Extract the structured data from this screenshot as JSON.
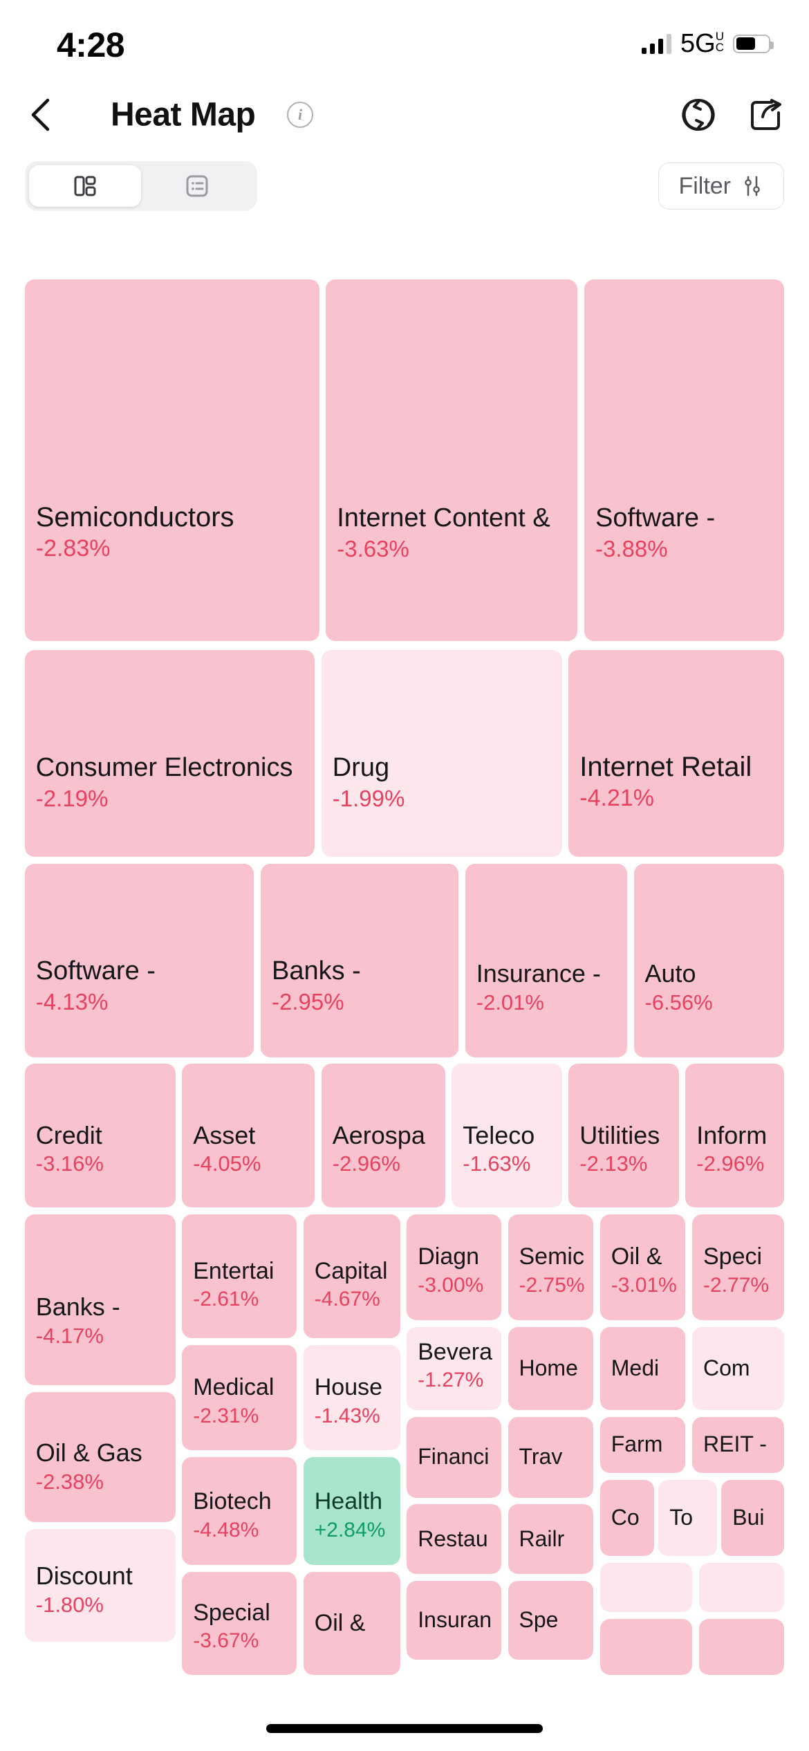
{
  "status_bar": {
    "time": "4:28",
    "network_label": "5G",
    "network_sup_top": "U",
    "network_sup_bottom": "C",
    "signal_icon": "cellular-bars-icon",
    "battery_icon": "battery-icon",
    "battery_level_pct": 62
  },
  "header": {
    "back_icon": "chevron-left-icon",
    "title": "Heat Map",
    "info_icon": "info-circle-icon",
    "info_glyph": "i",
    "refresh_icon": "refresh-icon",
    "share_icon": "share-export-icon"
  },
  "toolbar": {
    "view_toggle": {
      "options": [
        {
          "id": "grid",
          "icon": "grid-view-icon",
          "active": true
        },
        {
          "id": "list",
          "icon": "list-view-icon",
          "active": false
        }
      ]
    },
    "filter_label": "Filter",
    "filter_icon": "sliders-icon"
  },
  "colors": {
    "down_strong": "#f8c3ce",
    "down_mid": "#fac8d1",
    "down_light": "#fbdbe2",
    "down_lightest": "#fde7ec",
    "up_green_bg": "#a9e5cd",
    "pct_red": "#e8415f",
    "pct_green": "#0f9d67",
    "label_dark": "#15151a"
  },
  "chart_data": {
    "type": "treemap",
    "title": "Heat Map",
    "value_unit": "percent_change",
    "legend": "red = decline, green = gain; lighter shade = smaller move",
    "tiles": [
      {
        "label": "Semiconductors",
        "value": -2.83,
        "display": "-2.83%",
        "shade": "down_strong"
      },
      {
        "label": "Internet Content &",
        "value": -3.63,
        "display": "-3.63%",
        "shade": "down_strong"
      },
      {
        "label": "Software -",
        "value": -3.88,
        "display": "-3.88%",
        "shade": "down_strong"
      },
      {
        "label": "Consumer Electronics",
        "value": -2.19,
        "display": "-2.19%",
        "shade": "down_strong"
      },
      {
        "label": "Drug",
        "value": -1.99,
        "display": "-1.99%",
        "shade": "down_lightest"
      },
      {
        "label": "Internet Retail",
        "value": -4.21,
        "display": "-4.21%",
        "shade": "down_strong"
      },
      {
        "label": "Software -",
        "value": -4.13,
        "display": "-4.13%",
        "shade": "down_strong"
      },
      {
        "label": "Banks -",
        "value": -2.95,
        "display": "-2.95%",
        "shade": "down_strong"
      },
      {
        "label": "Insurance -",
        "value": -2.01,
        "display": "-2.01%",
        "shade": "down_strong"
      },
      {
        "label": "Auto",
        "value": -6.56,
        "display": "-6.56%",
        "shade": "down_strong"
      },
      {
        "label": "Credit",
        "value": -3.16,
        "display": "-3.16%",
        "shade": "down_strong"
      },
      {
        "label": "Asset",
        "value": -4.05,
        "display": "-4.05%",
        "shade": "down_strong"
      },
      {
        "label": "Aerospa",
        "value": -2.96,
        "display": "-2.96%",
        "shade": "down_strong"
      },
      {
        "label": "Teleco",
        "value": -1.63,
        "display": "-1.63%",
        "shade": "down_lightest"
      },
      {
        "label": "Utilities",
        "value": -2.13,
        "display": "-2.13%",
        "shade": "down_strong"
      },
      {
        "label": "Inform",
        "value": -2.96,
        "display": "-2.96%",
        "shade": "down_strong"
      },
      {
        "label": "Banks -",
        "value": -4.17,
        "display": "-4.17%",
        "shade": "down_strong"
      },
      {
        "label": "Entertai",
        "value": -2.61,
        "display": "-2.61%",
        "shade": "down_strong"
      },
      {
        "label": "Capital",
        "value": -4.67,
        "display": "-4.67%",
        "shade": "down_strong"
      },
      {
        "label": "Diagn",
        "value": -3.0,
        "display": "-3.00%",
        "shade": "down_strong"
      },
      {
        "label": "Semic",
        "value": -2.75,
        "display": "-2.75%",
        "shade": "down_strong"
      },
      {
        "label": "Oil &",
        "value": -3.01,
        "display": "-3.01%",
        "shade": "down_strong"
      },
      {
        "label": "Speci",
        "value": -2.77,
        "display": "-2.77%",
        "shade": "down_strong"
      },
      {
        "label": "Medical",
        "value": -2.31,
        "display": "-2.31%",
        "shade": "down_strong"
      },
      {
        "label": "House",
        "value": -1.43,
        "display": "-1.43%",
        "shade": "down_lightest"
      },
      {
        "label": "Bevera",
        "value": -1.27,
        "display": "-1.27%",
        "shade": "down_lightest"
      },
      {
        "label": "Home",
        "value": null,
        "display": "",
        "shade": "down_strong"
      },
      {
        "label": "Medi",
        "value": null,
        "display": "",
        "shade": "down_strong"
      },
      {
        "label": "Com",
        "value": null,
        "display": "",
        "shade": "down_lightest"
      },
      {
        "label": "Oil & Gas",
        "value": -2.38,
        "display": "-2.38%",
        "shade": "down_strong"
      },
      {
        "label": "Biotech",
        "value": -4.48,
        "display": "-4.48%",
        "shade": "down_strong"
      },
      {
        "label": "Health",
        "value": 2.84,
        "display": "+2.84%",
        "shade": "up_green_bg"
      },
      {
        "label": "Financi",
        "value": null,
        "display": "",
        "shade": "down_strong"
      },
      {
        "label": "Trav",
        "value": null,
        "display": "",
        "shade": "down_strong"
      },
      {
        "label": "Farm",
        "value": null,
        "display": "",
        "shade": "down_strong"
      },
      {
        "label": "REIT -",
        "value": null,
        "display": "",
        "shade": "down_strong"
      },
      {
        "label": "Restau",
        "value": null,
        "display": "",
        "shade": "down_strong"
      },
      {
        "label": "Railr",
        "value": null,
        "display": "",
        "shade": "down_strong"
      },
      {
        "label": "Co",
        "value": null,
        "display": "",
        "shade": "down_strong"
      },
      {
        "label": "To",
        "value": null,
        "display": "",
        "shade": "down_lightest"
      },
      {
        "label": "Bui",
        "value": null,
        "display": "",
        "shade": "down_strong"
      },
      {
        "label": "Discount",
        "value": -1.8,
        "display": "-1.80%",
        "shade": "down_lightest"
      },
      {
        "label": "Special",
        "value": -3.67,
        "display": "-3.67%",
        "shade": "down_strong"
      },
      {
        "label": "Oil &",
        "value": null,
        "display": "",
        "shade": "down_strong"
      },
      {
        "label": "Insuran",
        "value": null,
        "display": "",
        "shade": "down_strong"
      },
      {
        "label": "Spe",
        "value": null,
        "display": "",
        "shade": "down_strong"
      },
      {
        "label": "",
        "value": null,
        "display": "",
        "shade": "down_lightest"
      },
      {
        "label": "",
        "value": null,
        "display": "",
        "shade": "down_lightest"
      },
      {
        "label": "",
        "value": null,
        "display": "",
        "shade": "down_strong"
      },
      {
        "label": "",
        "value": null,
        "display": "",
        "shade": "down_strong"
      }
    ]
  }
}
